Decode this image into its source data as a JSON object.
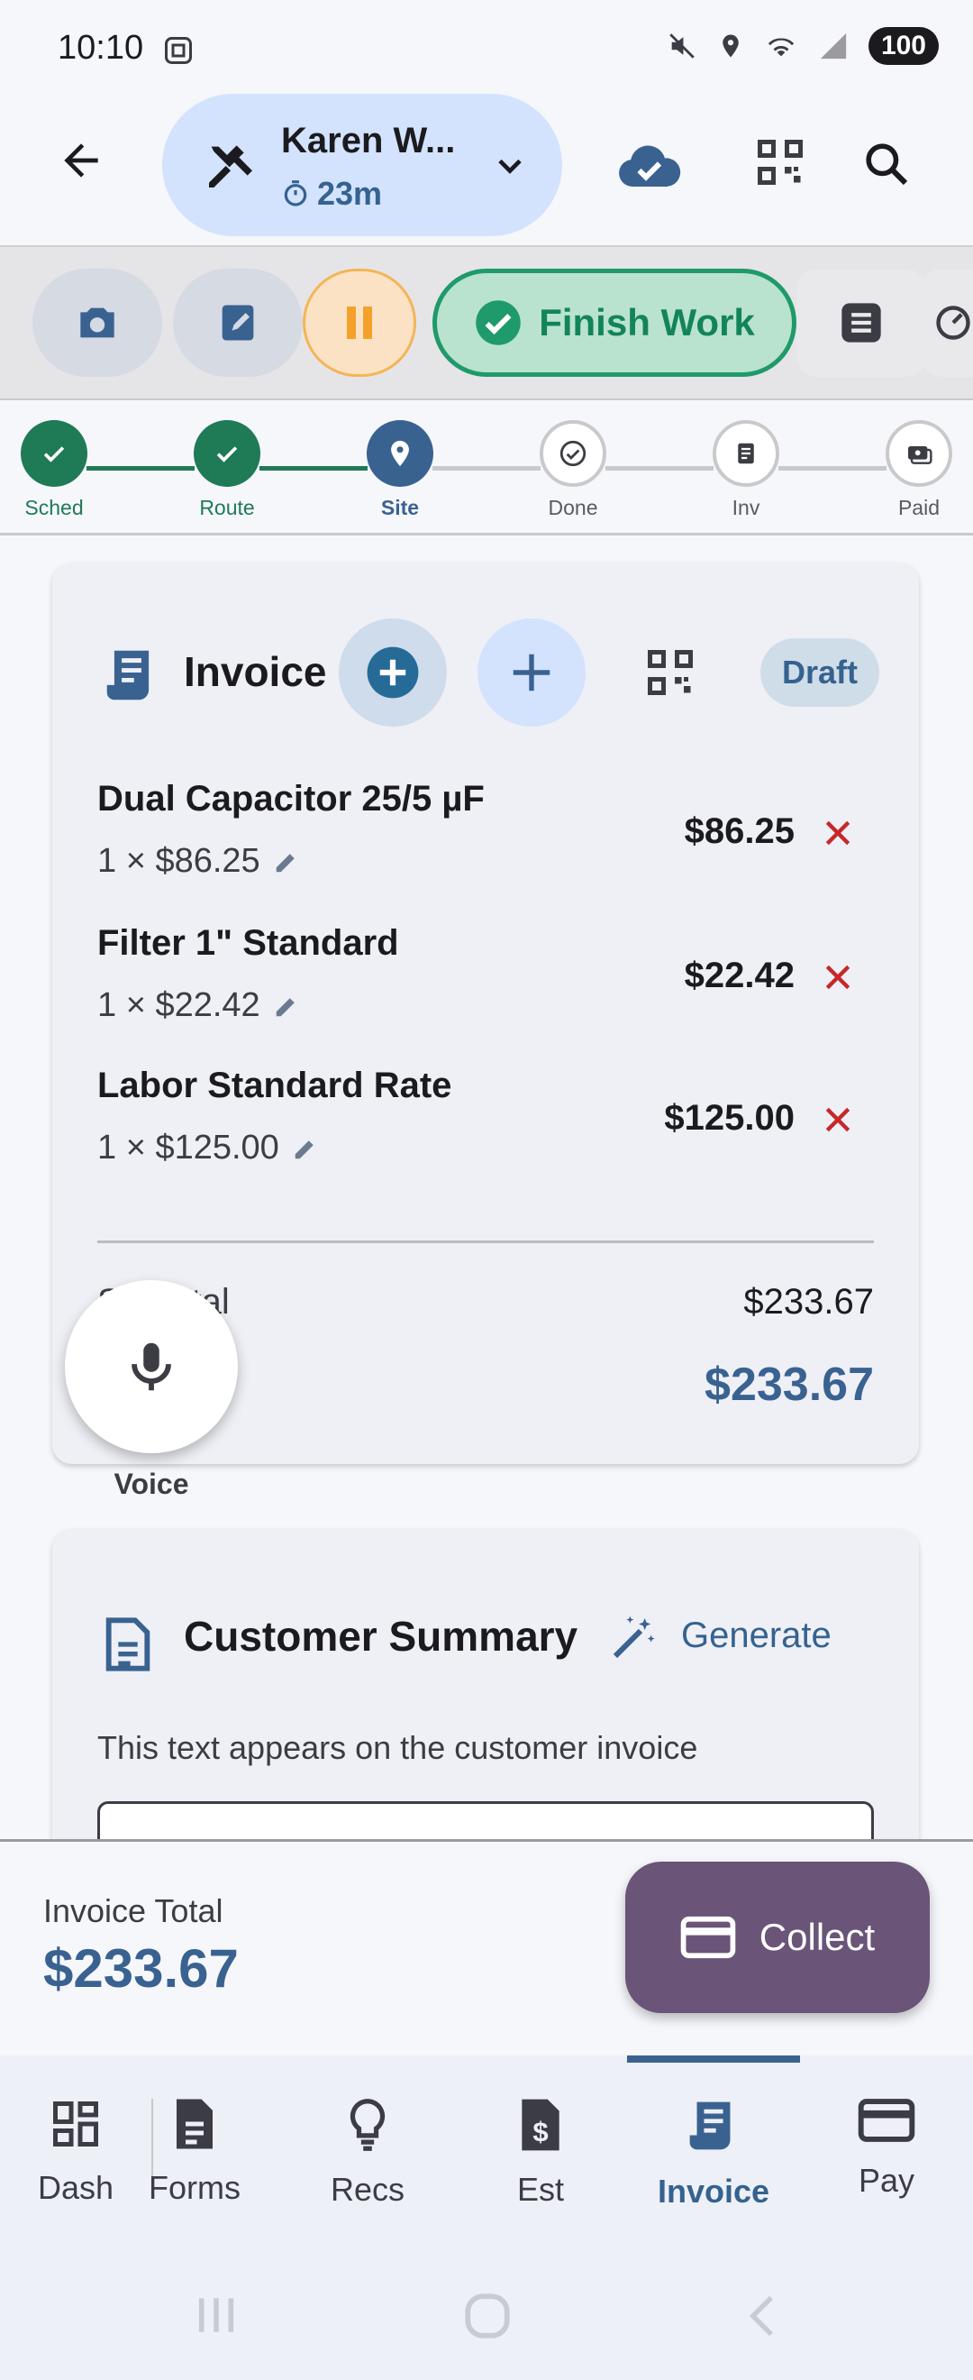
{
  "status_bar": {
    "time": "10:10",
    "battery": "100",
    "icons": [
      "screenshot-icon",
      "mute-icon",
      "location-icon",
      "wifi-icon",
      "signal-icon"
    ]
  },
  "app_bar": {
    "customer_name": "Karen W...",
    "elapsed": "23m"
  },
  "actions": {
    "finish_label": "Finish Work"
  },
  "stepper": {
    "steps": [
      {
        "label": "Sched",
        "state": "done"
      },
      {
        "label": "Route",
        "state": "done"
      },
      {
        "label": "Site",
        "state": "current"
      },
      {
        "label": "Done",
        "state": "todo"
      },
      {
        "label": "Inv",
        "state": "todo"
      },
      {
        "label": "Paid",
        "state": "todo"
      }
    ]
  },
  "invoice": {
    "title": "Invoice",
    "status": "Draft",
    "items": [
      {
        "name": "Dual Capacitor 25/5 µF",
        "qty": "1 × $86.25",
        "amount": "$86.25"
      },
      {
        "name": "Filter 1\" Standard",
        "qty": "1 × $22.42",
        "amount": "$22.42"
      },
      {
        "name": "Labor Standard Rate",
        "qty": "1 × $125.00",
        "amount": "$125.00"
      }
    ],
    "subtotal_label": "Subtotal",
    "subtotal": "$233.67",
    "total": "$233.67"
  },
  "voice": {
    "label": "Voice"
  },
  "summary": {
    "title": "Customer Summary",
    "generate_label": "Generate",
    "hint": "This text appears on the customer invoice"
  },
  "bottom": {
    "total_label": "Invoice Total",
    "total": "$233.67",
    "collect_label": "Collect"
  },
  "nav": {
    "items": [
      {
        "label": "Dash"
      },
      {
        "label": "Forms"
      },
      {
        "label": "Recs"
      },
      {
        "label": "Est"
      },
      {
        "label": "Invoice"
      },
      {
        "label": "Pay"
      }
    ],
    "active": "Invoice"
  },
  "colors": {
    "accent": "#3a6291",
    "success": "#1f7a56",
    "danger": "#c62828",
    "collect": "#6a5478",
    "pause": "#f4a12b"
  }
}
